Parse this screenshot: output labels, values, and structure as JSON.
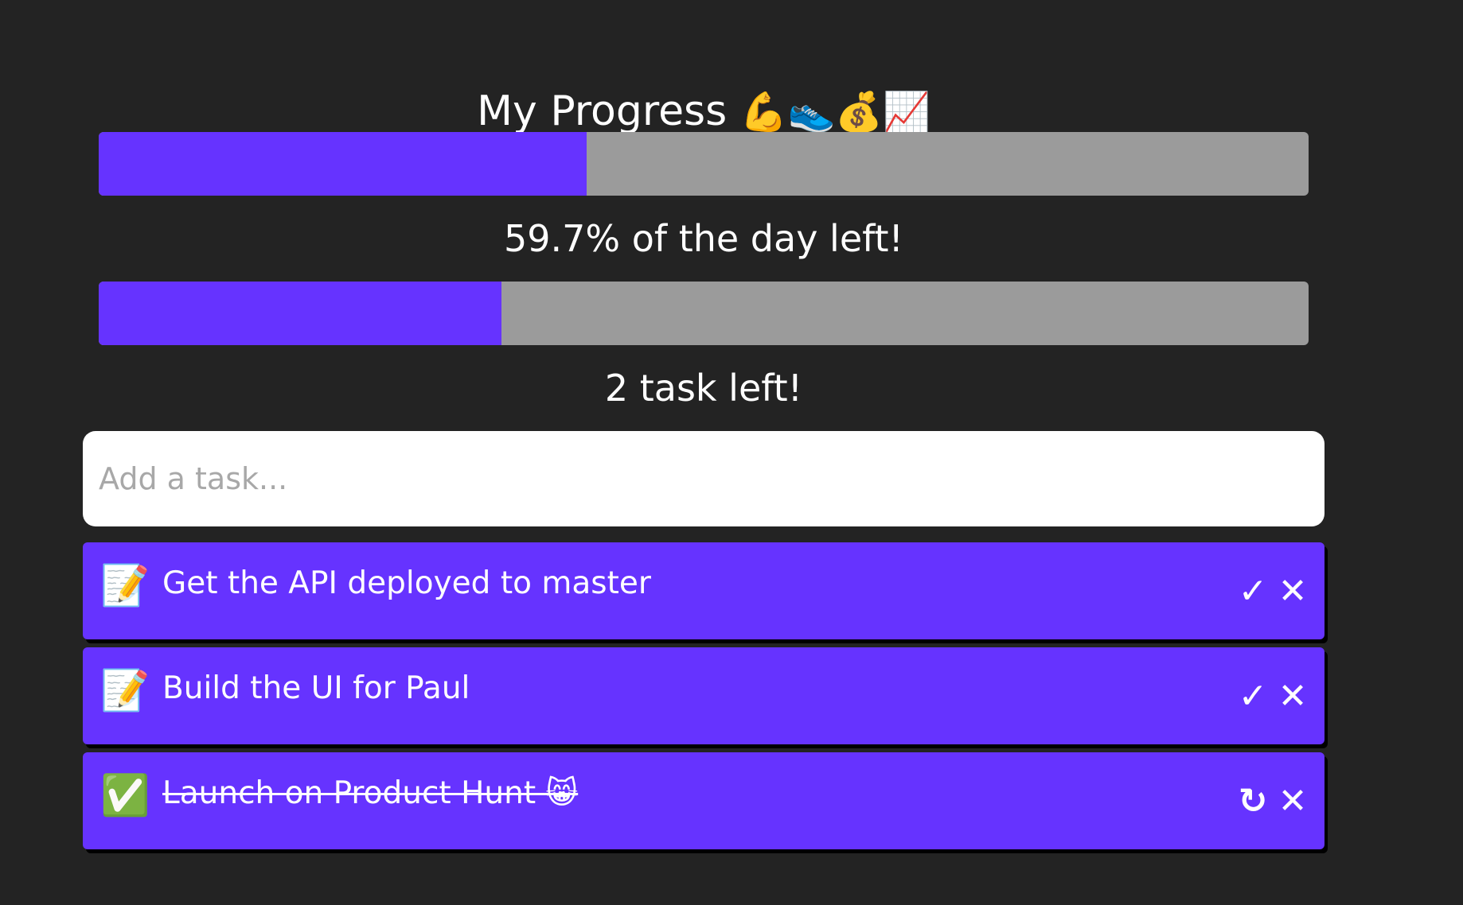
{
  "header": {
    "title": "My Progress",
    "title_emojis": "💪👟💰📈"
  },
  "day_progress": {
    "elapsed_fraction": 0.403,
    "caption": "59.7% of the day left!"
  },
  "task_progress": {
    "done_fraction": 0.333,
    "caption": "2 task left!"
  },
  "task_input": {
    "placeholder": "Add a task...",
    "value": ""
  },
  "tasks": [
    {
      "status_emoji": "📝",
      "status_icon": "memo-icon",
      "text": "Get the API deployed to master",
      "done": false,
      "primary_action": "✓",
      "primary_action_icon": "check-icon",
      "delete_action": "✕",
      "delete_action_icon": "close-icon"
    },
    {
      "status_emoji": "📝",
      "status_icon": "memo-icon",
      "text": "Build the UI for Paul",
      "done": false,
      "primary_action": "✓",
      "primary_action_icon": "check-icon",
      "delete_action": "✕",
      "delete_action_icon": "close-icon"
    },
    {
      "status_emoji": "✅",
      "status_icon": "check-mark-button-icon",
      "text": "Launch on Product Hunt 😸",
      "done": true,
      "primary_action": "↻",
      "primary_action_icon": "undo-icon",
      "delete_action": "✕",
      "delete_action_icon": "close-icon"
    }
  ],
  "colors": {
    "background": "#232323",
    "accent": "#6633ff",
    "track": "#9b9b9b",
    "text": "#ffffff"
  }
}
